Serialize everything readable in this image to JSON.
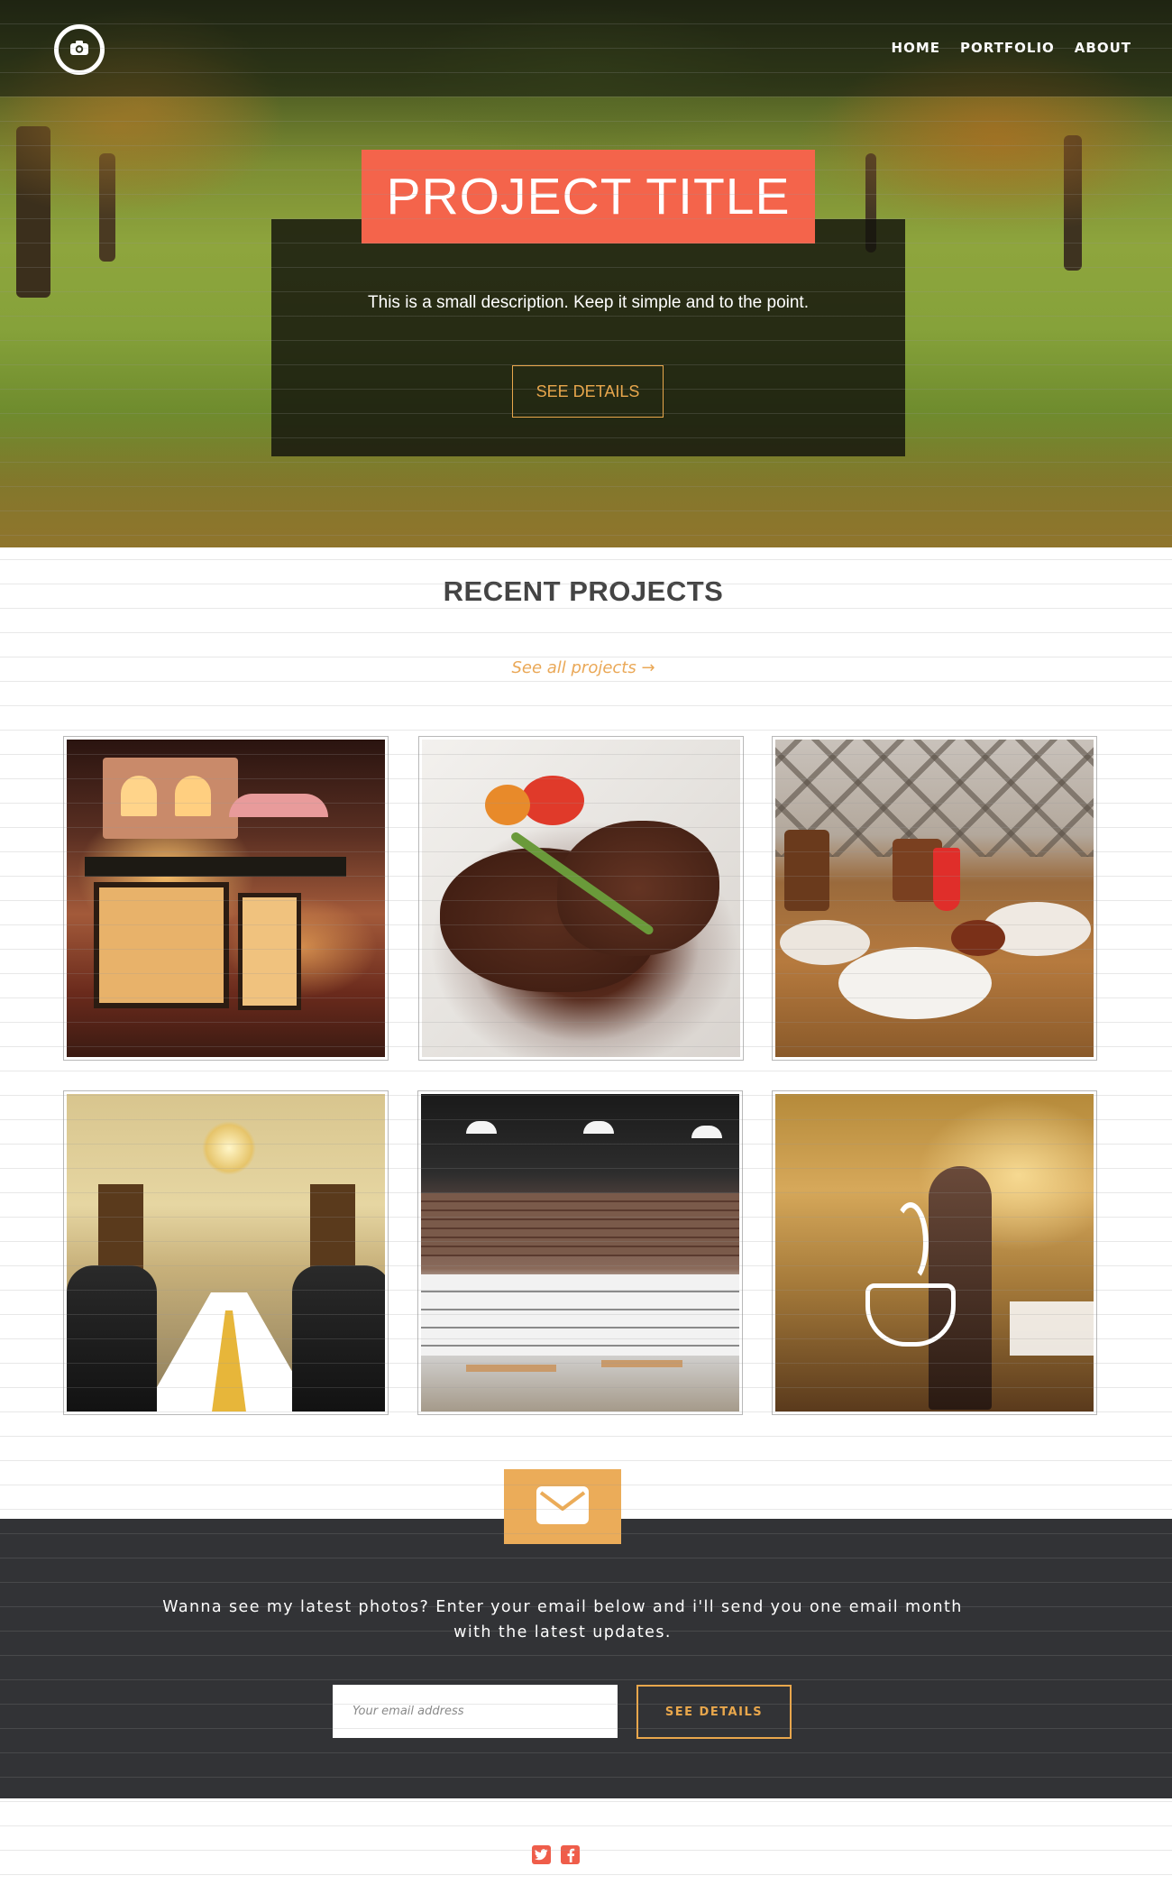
{
  "nav": {
    "logo_icon": "camera-icon",
    "links": [
      "HOME",
      "PORTFOLIO",
      "ABOUT"
    ]
  },
  "hero": {
    "title": "PROJECT TITLE",
    "description": "This is a small description. Keep it simple and to the point.",
    "button_label": "SEE DETAILS"
  },
  "projects": {
    "heading": "RECENT PROJECTS",
    "see_all": "See all projects →",
    "items": [
      {
        "subject": "miniature cafe dollhouse"
      },
      {
        "subject": "grilled steak with vegetables"
      },
      {
        "subject": "restaurant table with dishes"
      },
      {
        "subject": "formal banquet dining hall"
      },
      {
        "subject": "industrial style cafe interior"
      },
      {
        "subject": "coffee shop window with latte art"
      }
    ]
  },
  "newsletter": {
    "icon": "envelope-icon",
    "text": "Wanna see my latest photos? Enter your email below and i'll send you one email month with the latest updates.",
    "email_placeholder": "Your email address",
    "button_label": "SEE DETAILS"
  },
  "footer": {
    "social_icons": [
      "twitter-icon",
      "facebook-icon"
    ]
  },
  "colors": {
    "accent_red": "#f4644b",
    "accent_orange": "#e9a74c",
    "dark_band": "#323336"
  }
}
